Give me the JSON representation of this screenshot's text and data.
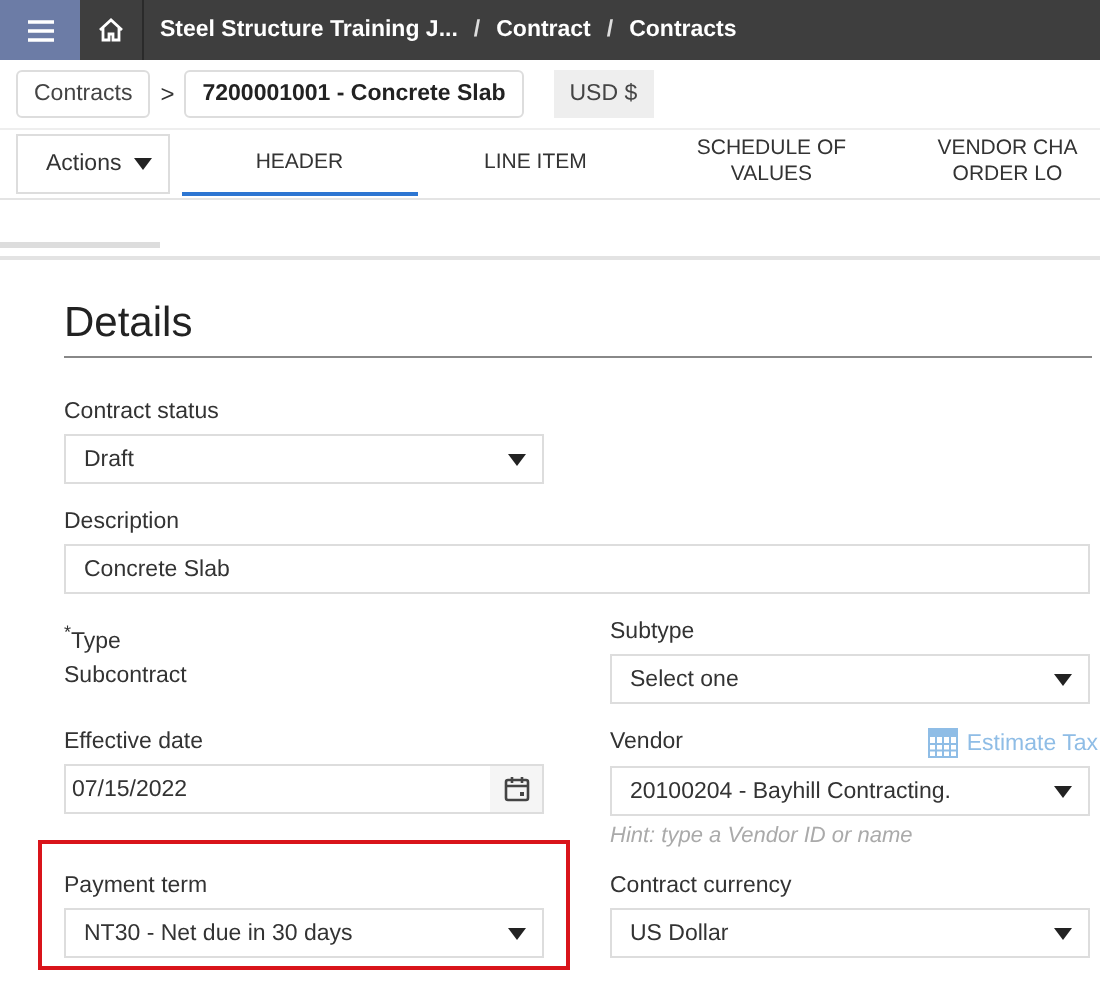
{
  "topbar": {
    "breadcrumbs": [
      "Steel Structure Training J...",
      "Contract",
      "Contracts"
    ],
    "separator": "/"
  },
  "record_bar": {
    "parent": "Contracts",
    "separator": ">",
    "record": "7200001001 - Concrete Slab",
    "currency": "USD $"
  },
  "actions": {
    "label": "Actions"
  },
  "tabs": [
    {
      "label": "HEADER",
      "selected": true
    },
    {
      "label": "LINE ITEM",
      "selected": false
    },
    {
      "label": "SCHEDULE OF VALUES",
      "selected": false
    },
    {
      "label": "VENDOR CHA\nORDER LO",
      "selected": false
    }
  ],
  "section": {
    "title": "Details"
  },
  "rows": [
    {
      "fields": [
        {
          "kind": "select",
          "label": "Contract status",
          "value": "Draft"
        }
      ]
    },
    {
      "fields": [
        {
          "kind": "text",
          "label": "Description",
          "value": "Concrete Slab"
        }
      ]
    },
    {
      "fields": [
        {
          "kind": "readonly",
          "label": "Type",
          "required_mark": "*",
          "value": "Subcontract"
        },
        {
          "kind": "select",
          "label": "Subtype",
          "value": "Select one"
        }
      ]
    },
    {
      "fields": [
        {
          "kind": "date",
          "label": "Effective date",
          "value": "07/15/2022"
        },
        {
          "kind": "select",
          "label": "Vendor",
          "value": "20100204 - Bayhill Contracting.",
          "link": "Estimate Tax",
          "hint": "Hint: type a Vendor ID or name"
        }
      ]
    },
    {
      "fields": [
        {
          "kind": "select",
          "label": "Payment term",
          "value": "NT30 - Net due in 30 days",
          "highlighted": true
        },
        {
          "kind": "select",
          "label": "Contract currency",
          "value": "US Dollar"
        }
      ]
    }
  ]
}
